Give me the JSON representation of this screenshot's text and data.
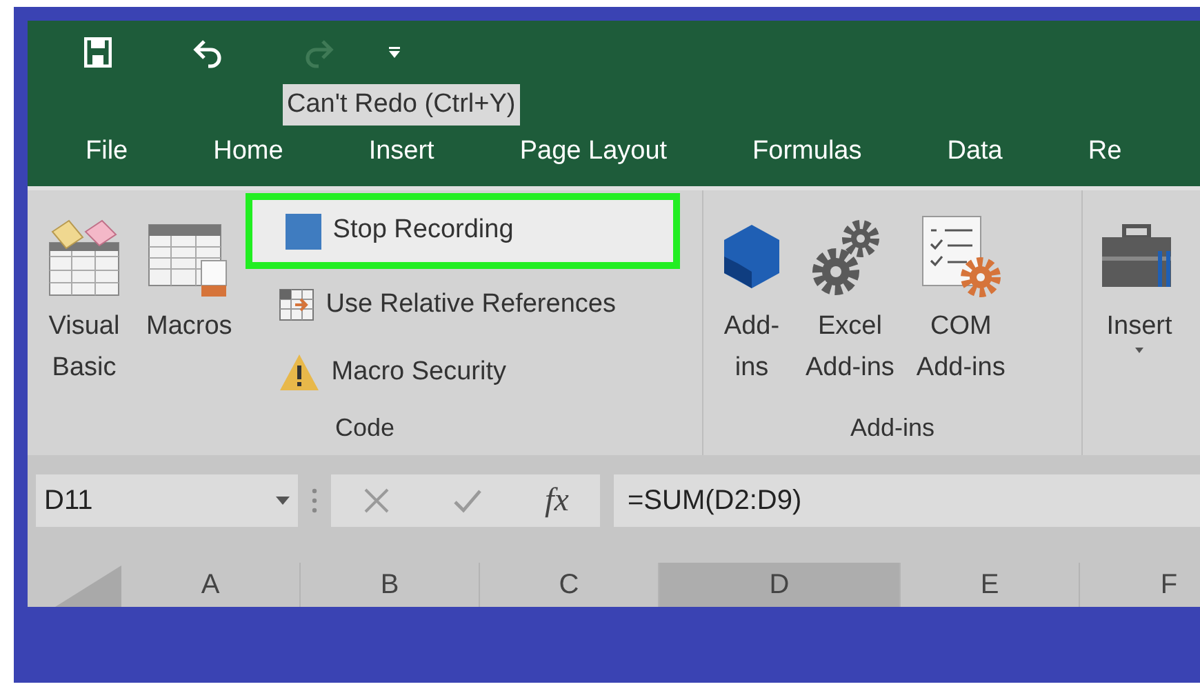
{
  "quick_access": [
    {
      "kind": "save",
      "disabled": false
    },
    {
      "kind": "undo",
      "disabled": false
    },
    {
      "kind": "redo",
      "disabled": true
    },
    {
      "kind": "customize",
      "disabled": false
    }
  ],
  "tooltip": "Can't Redo (Ctrl+Y)",
  "tabs": [
    "File",
    "Home",
    "Insert",
    "Page Layout",
    "Formulas",
    "Data",
    "Re"
  ],
  "ribbon": {
    "groups": [
      {
        "label": "Code",
        "large_buttons": [
          {
            "kind": "visual_basic",
            "label": "Visual\nBasic"
          },
          {
            "kind": "macros",
            "label": "Macros"
          }
        ],
        "small_buttons": [
          {
            "kind": "stop",
            "label": "Stop Recording",
            "highlighted": true
          },
          {
            "kind": "relative",
            "label": "Use Relative References",
            "highlighted": false
          },
          {
            "kind": "security",
            "label": "Macro Security",
            "highlighted": false
          }
        ]
      },
      {
        "label": "Add-ins",
        "large_buttons": [
          {
            "kind": "addins",
            "label": "Add-\nins",
            "dropdown": false
          },
          {
            "kind": "excel_addins",
            "label": "Excel\nAdd-ins",
            "dropdown": false
          },
          {
            "kind": "com_addins",
            "label": "COM\nAdd-ins",
            "dropdown": false
          }
        ]
      },
      {
        "large_buttons": [
          {
            "kind": "insert",
            "label": "Insert",
            "dropdown": true
          }
        ]
      }
    ]
  },
  "formula_bar": {
    "name_box": "D11",
    "fx": "fx",
    "formula": "=SUM(D2:D9)"
  },
  "columns": [
    {
      "label": "A",
      "selected": false
    },
    {
      "label": "B",
      "selected": false
    },
    {
      "label": "C",
      "selected": false
    },
    {
      "label": "D",
      "selected": true
    },
    {
      "label": "E",
      "selected": false
    },
    {
      "label": "F",
      "selected": false
    }
  ]
}
